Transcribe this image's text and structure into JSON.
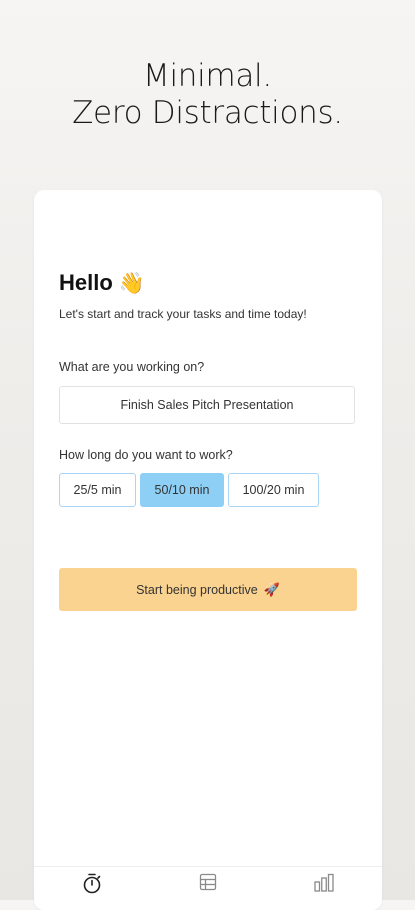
{
  "headline": {
    "line1": "Minimal.",
    "line2": "Zero Distractions."
  },
  "greeting": {
    "title": "Hello",
    "emoji": "👋",
    "subtitle": "Let's start and track your tasks and time today!"
  },
  "task": {
    "label": "What are you working on?",
    "value": "Finish Sales Pitch Presentation"
  },
  "duration": {
    "label": "How long do you want to work?",
    "options": [
      "25/5 min",
      "50/10 min",
      "100/20 min"
    ],
    "selected": "50/10 min"
  },
  "start_button": {
    "label": "Start being productive",
    "emoji": "🚀"
  },
  "tabbar": {
    "tabs": [
      {
        "icon": "stopwatch-icon"
      },
      {
        "icon": "table-icon"
      },
      {
        "icon": "bar-chart-icon"
      }
    ]
  },
  "colors": {
    "selected_option": "#8ecff5",
    "option_border": "#a9d6f5",
    "start_button": "#fbd391"
  }
}
